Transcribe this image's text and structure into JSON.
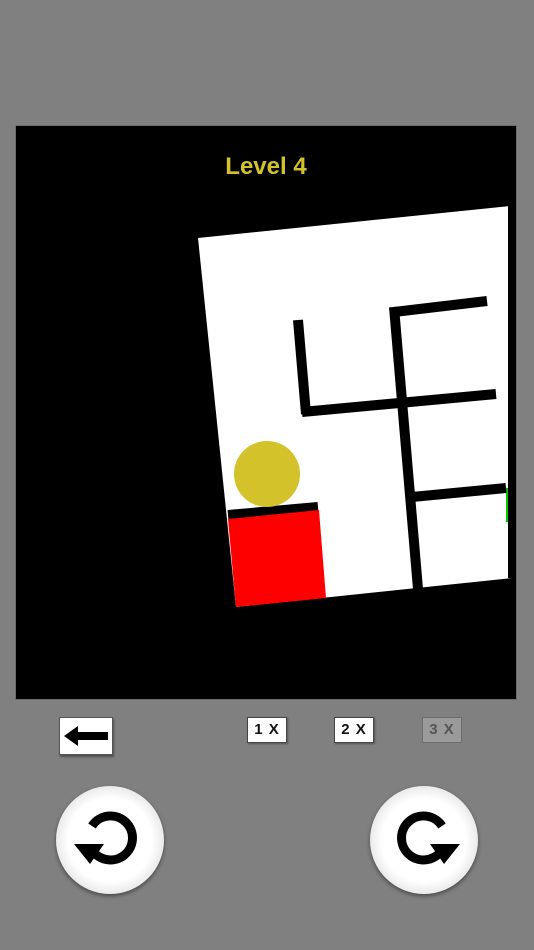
{
  "game": {
    "level_label": "Level 4",
    "colors": {
      "background": "#808080",
      "stage": "#000000",
      "board": "#ffffff",
      "walls": "#000000",
      "ball": "#d4c22a",
      "start_block": "#ff0000",
      "goal_marker": "#00cc00",
      "title": "#d4c22a"
    }
  },
  "controls": {
    "back_icon": "left-arrow-icon",
    "speed_options": [
      "1 X",
      "2 X",
      "3 X"
    ],
    "selected_speed": "3 X",
    "rotate_left_icon": "rotate-counterclockwise-icon",
    "rotate_right_icon": "rotate-clockwise-icon"
  }
}
